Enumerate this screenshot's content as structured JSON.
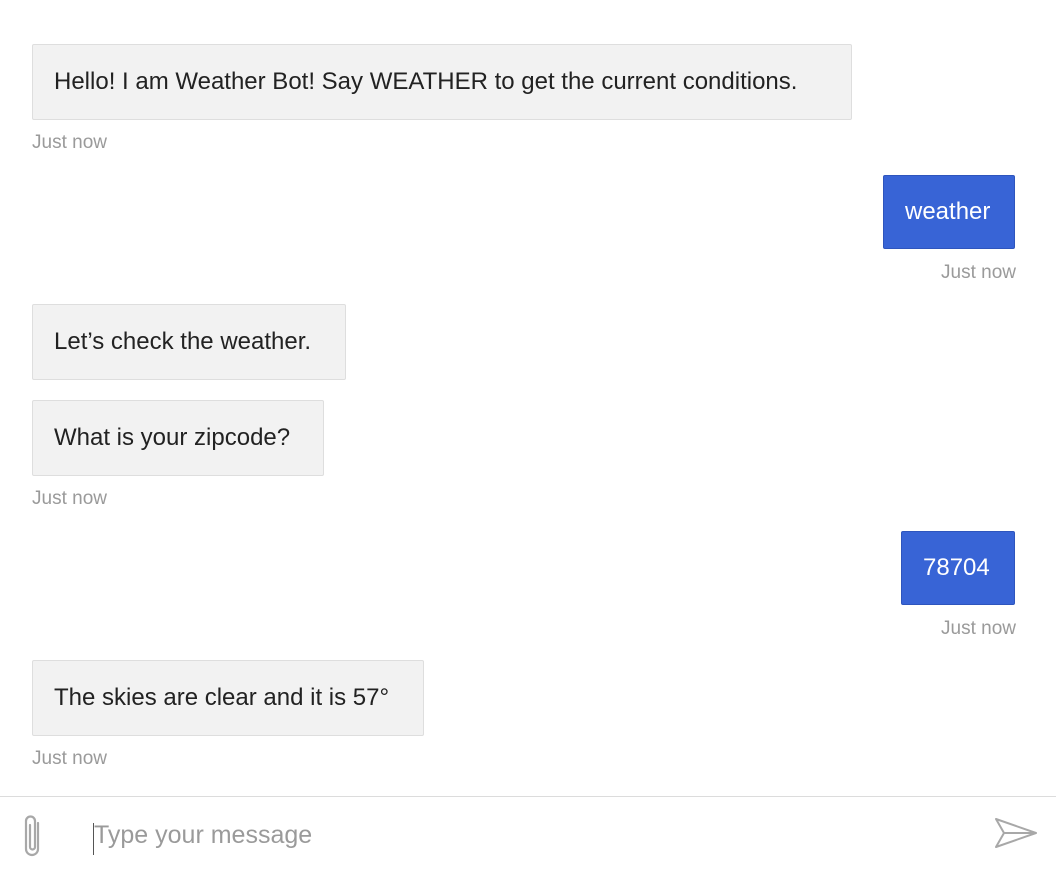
{
  "messages": [
    {
      "sender": "bot",
      "text": "Hello! I am Weather Bot! Say WEATHER to get the current conditions."
    },
    {
      "sender": "bot",
      "time": "Just now"
    },
    {
      "sender": "user",
      "text": "weather",
      "time": "Just now"
    },
    {
      "sender": "bot",
      "text": "Let’s check the weather."
    },
    {
      "sender": "bot",
      "text": "What is your zipcode?",
      "time": "Just now"
    },
    {
      "sender": "user",
      "text": "78704",
      "time": "Just now"
    },
    {
      "sender": "bot",
      "text": "The skies are clear and it is 57°",
      "time": "Just now"
    }
  ],
  "composer": {
    "placeholder": "Type your message",
    "attach_icon": "paperclip-icon",
    "send_icon": "paper-plane-send-icon"
  },
  "colors": {
    "user_bubble": "#3864d6",
    "bot_bubble": "#f2f2f2",
    "timestamp": "#9a9a9a"
  }
}
